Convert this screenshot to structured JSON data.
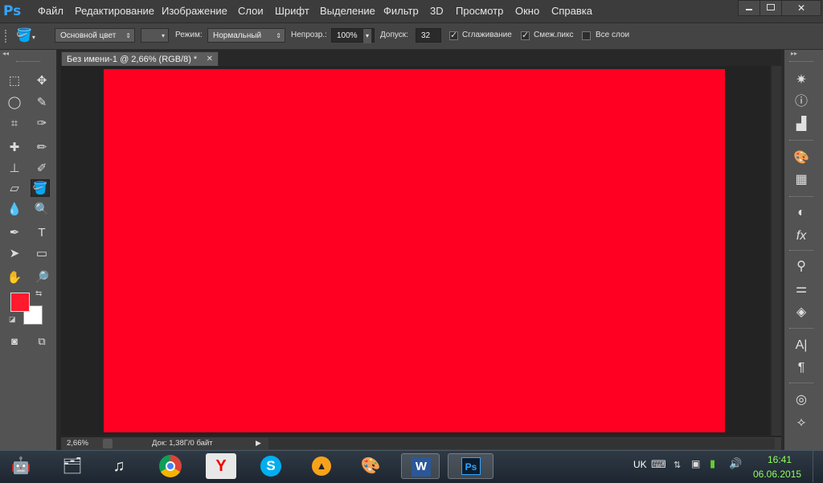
{
  "app": {
    "logo": "Ps"
  },
  "menu": [
    "Файл",
    "Редактирование",
    "Изображение",
    "Слои",
    "Шрифт",
    "Выделение",
    "Фильтр",
    "3D",
    "Просмотр",
    "Окно",
    "Справка"
  ],
  "options": {
    "preset_icon": "paint-bucket-icon",
    "fill_source": "Основной цвет",
    "mode_label": "Режим:",
    "mode_value": "Нормальный",
    "opacity_label": "Непрозр.:",
    "opacity_value": "100%",
    "tolerance_label": "Допуск:",
    "tolerance_value": "32",
    "antialias_label": "Сглаживание",
    "antialias_checked": true,
    "contiguous_label": "Смеж.пикс",
    "contiguous_checked": true,
    "all_layers_label": "Все слои",
    "all_layers_checked": false
  },
  "document": {
    "tab_title": "Без имени-1 @ 2,66% (RGB/8) *",
    "canvas_color": "#ff0022",
    "zoom": "2,66%",
    "doc_info": "Док: 1,38Г/0 байт"
  },
  "colors": {
    "foreground": "#ff1a2e",
    "background": "#ffffff",
    "accent": "#33a4ff"
  },
  "taskbar": {
    "lang": "UK",
    "time": "16:41",
    "date": "06.06.2015",
    "apps": [
      "android-icon",
      "file-manager-icon",
      "music-icon",
      "chrome-icon",
      "yandex-browser-icon",
      "skype-icon",
      "aimp-icon",
      "paint-icon",
      "word-icon",
      "photoshop-icon"
    ]
  }
}
